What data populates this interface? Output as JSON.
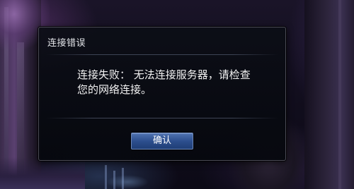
{
  "dialog": {
    "title": "连接错误",
    "message_line1": "连接失败： 无法连接服务器，请检查",
    "message_line2": "您的网络连接。",
    "confirm_label": "确认"
  },
  "colors": {
    "confirm_button": "#2d4f8e",
    "dialog_background": "#0a0c14",
    "dialog_border": "#4a4a55"
  }
}
